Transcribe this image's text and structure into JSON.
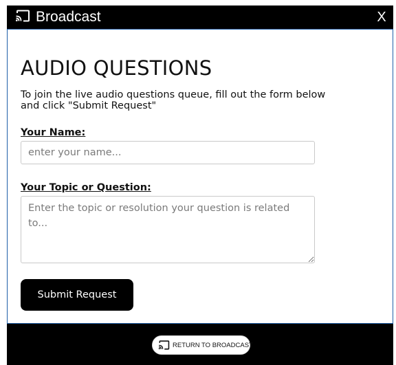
{
  "window": {
    "title": "Broadcast",
    "close_label": "X"
  },
  "form": {
    "heading": "AUDIO QUESTIONS",
    "intro": "To join the live audio questions queue, fill out the form below and click \"Submit Request\"",
    "name_label": "Your Name:",
    "name_placeholder": "enter your name...",
    "name_value": "",
    "topic_label": "Your Topic or Question:",
    "topic_placeholder": "Enter the topic or resolution your question is related to...",
    "topic_value": "",
    "submit_label": "Submit Request"
  },
  "footer": {
    "return_label": "RETURN TO BROADCAST"
  },
  "icons": {
    "title_icon": "cast-icon",
    "return_icon": "cast-icon"
  },
  "colors": {
    "titlebar_bg": "#000000",
    "border_accent": "#1f5fa8",
    "button_bg": "#000000",
    "footer_bg": "#000000"
  }
}
